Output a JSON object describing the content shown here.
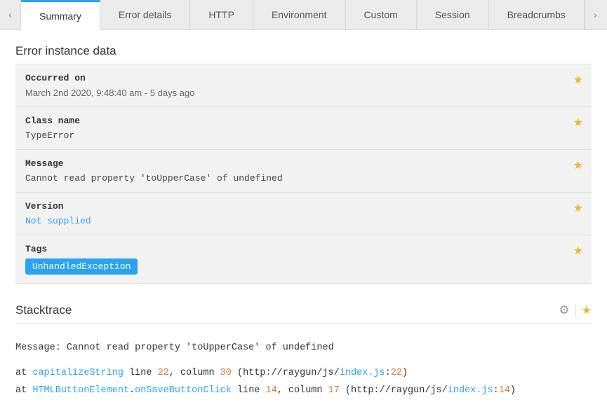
{
  "tabs": {
    "items": [
      {
        "label": "Summary",
        "active": true
      },
      {
        "label": "Error details",
        "active": false
      },
      {
        "label": "HTTP",
        "active": false
      },
      {
        "label": "Environment",
        "active": false
      },
      {
        "label": "Custom",
        "active": false
      },
      {
        "label": "Session",
        "active": false
      },
      {
        "label": "Breadcrumbs",
        "active": false
      }
    ]
  },
  "instance": {
    "title": "Error instance data",
    "occurred_label": "Occurred on",
    "occurred_value": "March 2nd 2020, 9:48:40 am - 5 days ago",
    "class_label": "Class name",
    "class_value": "TypeError",
    "message_label": "Message",
    "message_value": "Cannot read property 'toUpperCase' of undefined",
    "version_label": "Version",
    "version_value": "Not supplied",
    "tags_label": "Tags",
    "tag_value": "UnhandledException"
  },
  "stacktrace": {
    "title": "Stacktrace",
    "message_prefix": "Message: ",
    "message": "Cannot read property 'toUpperCase' of undefined",
    "frames": [
      {
        "prefix": "at ",
        "method": "capitalizeString",
        "line_word": " line ",
        "line": "22",
        "col_word": ", column ",
        "col": "30",
        "paren_open": " (",
        "path": "http://raygun/js/",
        "file": "index.js",
        "colon": ":",
        "file_line": "22",
        "paren_close": ")"
      },
      {
        "prefix": "at ",
        "class": "HTMLButtonElement",
        "dot": ".",
        "method": "onSaveButtonClick",
        "line_word": " line ",
        "line": "14",
        "col_word": ", column ",
        "col": "17",
        "paren_open": " (",
        "path": "http://raygun/js/",
        "file": "index.js",
        "colon": ":",
        "file_line": "14",
        "paren_close": ")"
      }
    ]
  }
}
